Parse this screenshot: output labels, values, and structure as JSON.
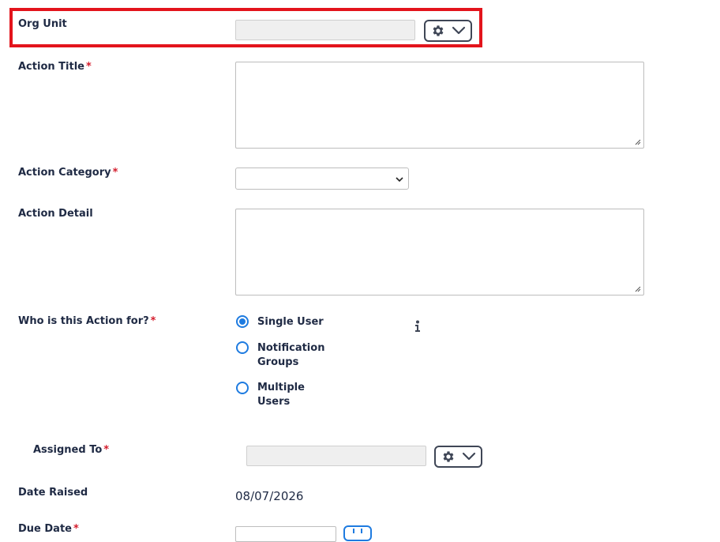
{
  "form": {
    "org_unit": {
      "label": "Org Unit"
    },
    "action_title": {
      "label": "Action Title",
      "required_mark": "*"
    },
    "action_category": {
      "label": "Action Category",
      "required_mark": "*",
      "selected": ""
    },
    "action_detail": {
      "label": "Action Detail"
    },
    "who_for": {
      "label": "Who is this Action for?",
      "required_mark": "*",
      "options": [
        {
          "line1": "Single User",
          "line2": "",
          "checked": true
        },
        {
          "line1": "Notification",
          "line2": "Groups",
          "checked": false
        },
        {
          "line1": "Multiple",
          "line2": "Users",
          "checked": false
        }
      ]
    },
    "assigned_to": {
      "label": "Assigned To",
      "required_mark": "*"
    },
    "date_raised": {
      "label": "Date Raised",
      "value": "08/07/2026"
    },
    "due_date": {
      "label": "Due Date",
      "required_mark": "*"
    }
  },
  "icons": {
    "gear": "gear-icon",
    "chevron": "chevron-down-icon",
    "info": "info-icon"
  },
  "colors": {
    "highlight": "#e3141c",
    "required": "#d41c2c",
    "radio_accent": "#1e7be0",
    "text": "#1f2a44"
  }
}
